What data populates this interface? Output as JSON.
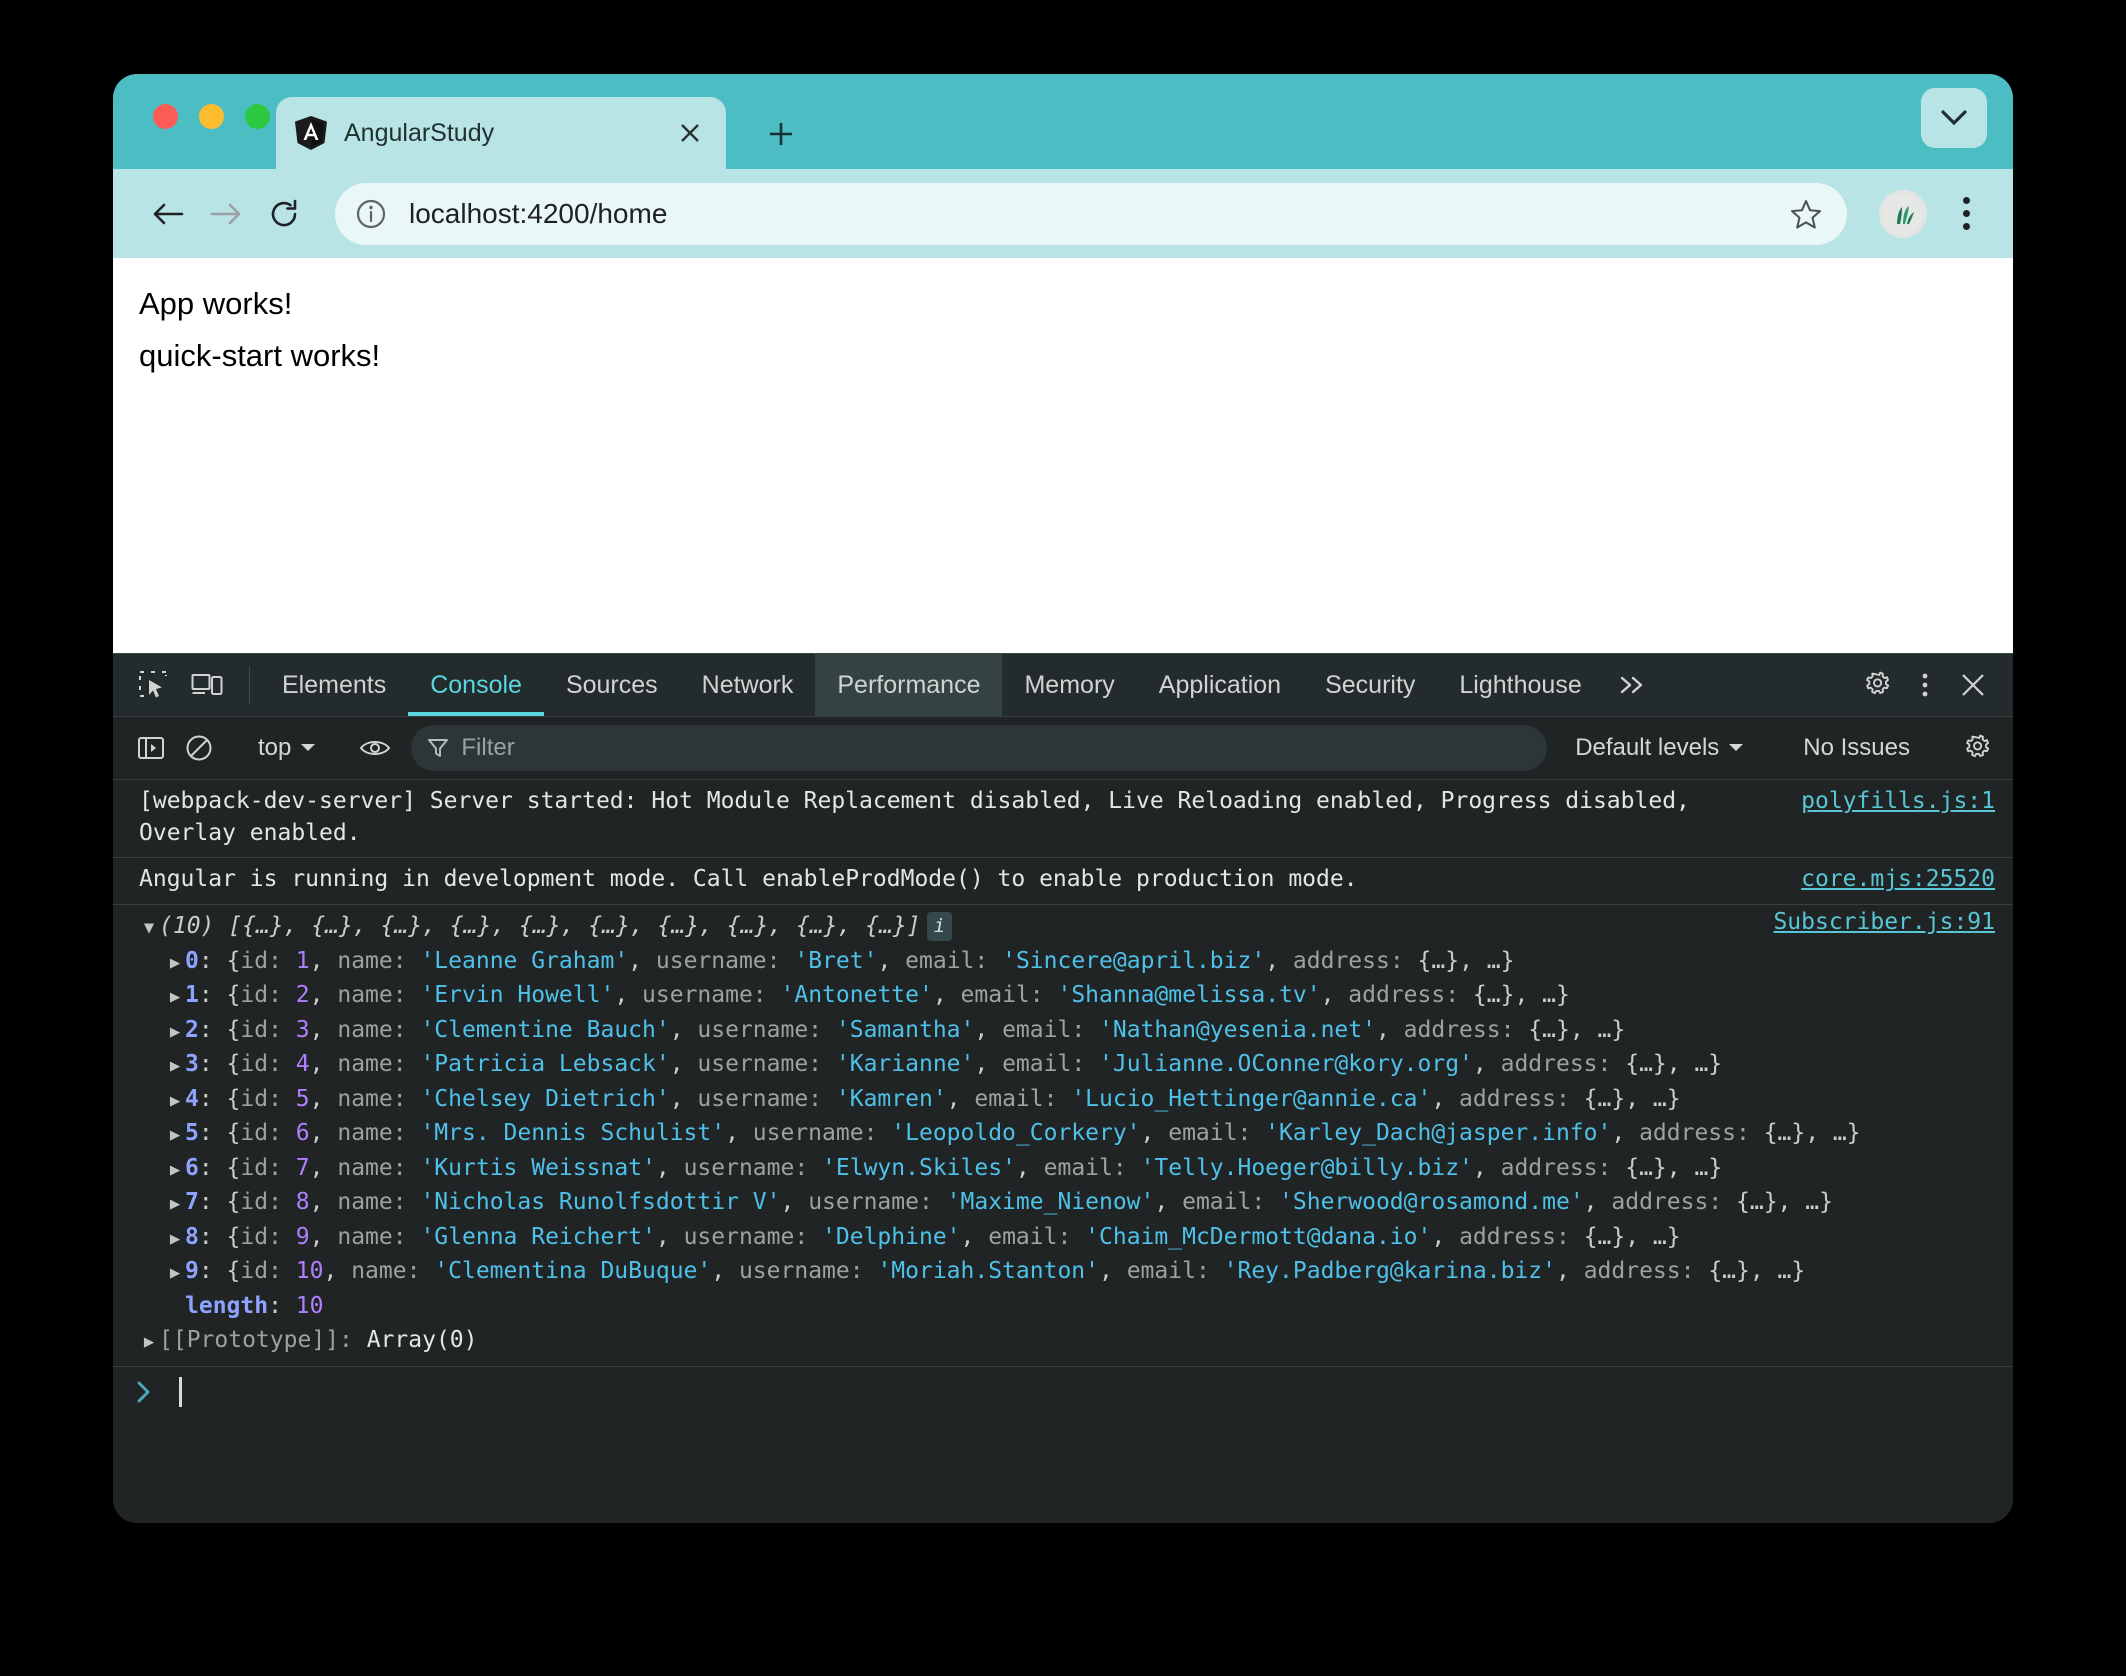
{
  "browser": {
    "tab": {
      "title": "AngularStudy",
      "favicon_icon": "angular-logo-icon",
      "close_icon": "close-icon"
    },
    "new_tab_icon": "plus-icon",
    "tab_list_chevron_icon": "chevron-down-icon",
    "nav": {
      "back_icon": "back-arrow-icon",
      "forward_icon": "forward-arrow-icon",
      "reload_icon": "reload-icon",
      "info_icon": "info-circle-icon",
      "url": "localhost:4200/home",
      "star_icon": "star-icon",
      "profile_icon": "profile-avatar-icon",
      "menu_icon": "kebab-menu-icon"
    },
    "colors": {
      "titlebar": "#4cbec3",
      "toolbar": "#b9e4e5",
      "omnibox": "#e9f7f7"
    }
  },
  "page": {
    "lines": [
      "App works!",
      "quick-start works!"
    ]
  },
  "devtools": {
    "toolbar_icons": [
      "inspect-element-icon",
      "device-toolbar-icon"
    ],
    "tabs": [
      {
        "label": "Elements",
        "state": "normal"
      },
      {
        "label": "Console",
        "state": "active"
      },
      {
        "label": "Sources",
        "state": "normal"
      },
      {
        "label": "Network",
        "state": "normal"
      },
      {
        "label": "Performance",
        "state": "hovered"
      },
      {
        "label": "Memory",
        "state": "normal"
      },
      {
        "label": "Application",
        "state": "normal"
      },
      {
        "label": "Security",
        "state": "normal"
      },
      {
        "label": "Lighthouse",
        "state": "normal"
      }
    ],
    "more_tabs_icon": "chevron-double-right-icon",
    "settings_icon": "gear-icon",
    "menu_icon": "kebab-menu-icon",
    "close_icon": "close-icon",
    "filterbar": {
      "sidebar_toggle_icon": "console-sidebar-icon",
      "clear_console_icon": "clear-console-icon",
      "context": "top",
      "context_chevron_icon": "chevron-down-icon",
      "live_expression_icon": "eye-icon",
      "filter_icon": "filter-funnel-icon",
      "filter_placeholder": "Filter",
      "filter_value": "",
      "levels": "Default levels",
      "levels_chevron_icon": "chevron-down-icon",
      "issues": "No Issues",
      "settings_icon": "gear-icon"
    },
    "accent_color": "#5ad6e0",
    "console": {
      "messages": [
        {
          "text": "[webpack-dev-server] Server started: Hot Module Replacement disabled, Live Reloading enabled, Progress disabled, Overlay enabled.",
          "source": "polyfills.js:1"
        },
        {
          "text": "Angular is running in development mode. Call enableProdMode() to enable production mode.",
          "source": "core.mjs:25520"
        }
      ],
      "array_log": {
        "source": "Subscriber.js:91",
        "header_count": "(10)",
        "header_preview": "[{…}, {…}, {…}, {…}, {…}, {…}, {…}, {…}, {…}, {…}]",
        "info_badge": "i",
        "entries": [
          {
            "index": "0",
            "id": "1",
            "name": "Leanne Graham",
            "username": "Bret",
            "email": "Sincere@april.biz"
          },
          {
            "index": "1",
            "id": "2",
            "name": "Ervin Howell",
            "username": "Antonette",
            "email": "Shanna@melissa.tv"
          },
          {
            "index": "2",
            "id": "3",
            "name": "Clementine Bauch",
            "username": "Samantha",
            "email": "Nathan@yesenia.net"
          },
          {
            "index": "3",
            "id": "4",
            "name": "Patricia Lebsack",
            "username": "Karianne",
            "email": "Julianne.OConner@kory.org"
          },
          {
            "index": "4",
            "id": "5",
            "name": "Chelsey Dietrich",
            "username": "Kamren",
            "email": "Lucio_Hettinger@annie.ca"
          },
          {
            "index": "5",
            "id": "6",
            "name": "Mrs. Dennis Schulist",
            "username": "Leopoldo_Corkery",
            "email": "Karley_Dach@jasper.info"
          },
          {
            "index": "6",
            "id": "7",
            "name": "Kurtis Weissnat",
            "username": "Elwyn.Skiles",
            "email": "Telly.Hoeger@billy.biz"
          },
          {
            "index": "7",
            "id": "8",
            "name": "Nicholas Runolfsdottir V",
            "username": "Maxime_Nienow",
            "email": "Sherwood@rosamond.me"
          },
          {
            "index": "8",
            "id": "9",
            "name": "Glenna Reichert",
            "username": "Delphine",
            "email": "Chaim_McDermott@dana.io"
          },
          {
            "index": "9",
            "id": "10",
            "name": "Clementina DuBuque",
            "username": "Moriah.Stanton",
            "email": "Rey.Padberg@karina.biz"
          }
        ],
        "length_key": "length",
        "length_value": "10",
        "proto_key": "[[Prototype]]",
        "proto_value": "Array(0)"
      },
      "prompt_caret_icon": "chevron-right-icon"
    }
  }
}
